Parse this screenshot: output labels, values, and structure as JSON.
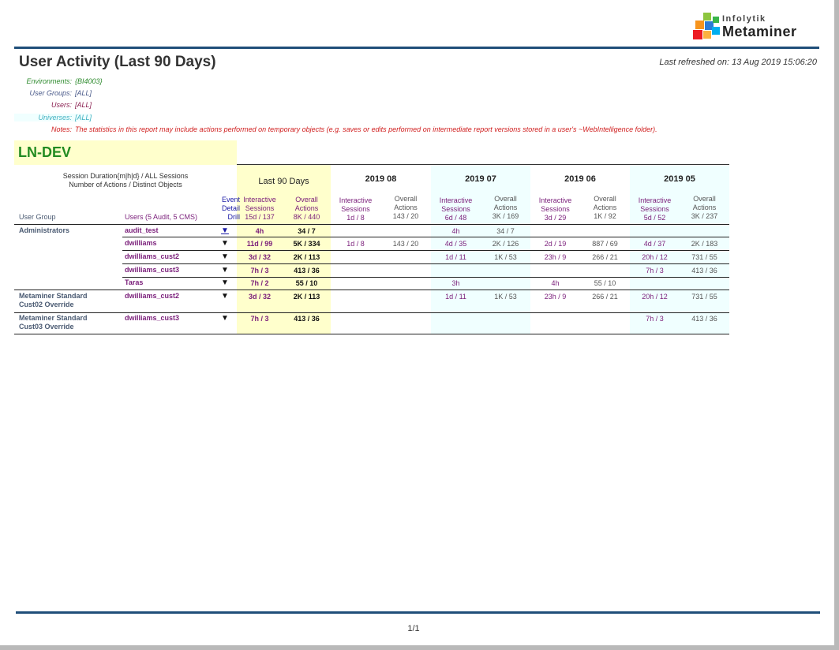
{
  "logo": {
    "small": "Infolytik",
    "big": "Metaminer"
  },
  "report": {
    "title": "User Activity (Last 90 Days)",
    "refreshed": "Last refreshed on: 13 Aug 2019 15:06:20"
  },
  "meta": {
    "environments": {
      "label": "Environments:",
      "value": "{BI4003}",
      "color": "#2e8b2e"
    },
    "user_groups": {
      "label": "User Groups:",
      "value": "[ALL]",
      "color": "#4a5a8a"
    },
    "users": {
      "label": "Users:",
      "value": "[ALL]",
      "color": "#8b2252"
    },
    "universes": {
      "label": "Universes:",
      "value": "[ALL]",
      "color": "#3fb0c0"
    },
    "notes": {
      "label": "Notes:",
      "value": "The statistics in this report may include actions performed on temporary objects (e.g. saves or edits performed on intermediate report versions stored in a user's ~WebIntelligence folder).",
      "color": "#d02020"
    }
  },
  "section": {
    "name": "LN-DEV"
  },
  "legend": {
    "line1": "Session Duration{m|h|d} / ALL Sessions",
    "line2": "Number of Actions / Distinct Objects"
  },
  "columns": {
    "user_group": "User Group",
    "users": "Users (5 Audit, 5 CMS)",
    "drill": [
      "Event",
      "Detail",
      "Drill"
    ],
    "interactive": [
      "Interactive",
      "Sessions"
    ],
    "overall": [
      "Overall",
      "Actions"
    ]
  },
  "periods": [
    {
      "title": "Last 90 Days",
      "interactive_total": "15d / 137",
      "overall_total": "8K / 440",
      "band": "#ffffcc"
    },
    {
      "title": "2019 08",
      "interactive_total": "1d / 8",
      "overall_total": "143 / 20",
      "band": "#ffffff"
    },
    {
      "title": "2019 07",
      "interactive_total": "6d / 48",
      "overall_total": "3K / 169",
      "band": "#f0ffff"
    },
    {
      "title": "2019 06",
      "interactive_total": "3d / 29",
      "overall_total": "1K / 92",
      "band": "#ffffff"
    },
    {
      "title": "2019 05",
      "interactive_total": "5d / 52",
      "overall_total": "3K / 237",
      "band": "#f0ffff"
    }
  ],
  "rows": [
    {
      "group": [
        "Administrators"
      ],
      "user": "audit_test",
      "drill": "▼",
      "values": [
        [
          "4h",
          "34 / 7"
        ],
        [
          "",
          ""
        ],
        [
          "4h",
          "34 / 7"
        ],
        [
          "",
          ""
        ],
        [
          "",
          ""
        ]
      ]
    },
    {
      "group": [],
      "user": "dwilliams",
      "drill": "▼",
      "values": [
        [
          "11d / 99",
          "5K / 334"
        ],
        [
          "1d / 8",
          "143 / 20"
        ],
        [
          "4d / 35",
          "2K / 126"
        ],
        [
          "2d / 19",
          "887 / 69"
        ],
        [
          "4d / 37",
          "2K / 183"
        ]
      ]
    },
    {
      "group": [],
      "user": "dwilliams_cust2",
      "drill": "▼",
      "values": [
        [
          "3d / 32",
          "2K / 113"
        ],
        [
          "",
          ""
        ],
        [
          "1d / 11",
          "1K / 53"
        ],
        [
          "23h / 9",
          "266 / 21"
        ],
        [
          "20h / 12",
          "731 / 55"
        ]
      ]
    },
    {
      "group": [],
      "user": "dwilliams_cust3",
      "drill": "▼",
      "values": [
        [
          "7h / 3",
          "413 / 36"
        ],
        [
          "",
          ""
        ],
        [
          "",
          ""
        ],
        [
          "",
          ""
        ],
        [
          "7h / 3",
          "413 / 36"
        ]
      ]
    },
    {
      "group": [],
      "user": "Taras",
      "drill": "▼",
      "values": [
        [
          "7h / 2",
          "55 / 10"
        ],
        [
          "",
          ""
        ],
        [
          "3h",
          ""
        ],
        [
          "4h",
          "55 / 10"
        ],
        [
          "",
          ""
        ]
      ]
    },
    {
      "group": [
        "Metaminer Standard",
        "Cust02 Override"
      ],
      "user": "dwilliams_cust2",
      "drill": "▼",
      "values": [
        [
          "3d / 32",
          "2K / 113"
        ],
        [
          "",
          ""
        ],
        [
          "1d / 11",
          "1K / 53"
        ],
        [
          "23h / 9",
          "266 / 21"
        ],
        [
          "20h / 12",
          "731 / 55"
        ]
      ]
    },
    {
      "group": [
        "Metaminer Standard",
        "Cust03 Override"
      ],
      "user": "dwilliams_cust3",
      "drill": "▼",
      "values": [
        [
          "7h / 3",
          "413 / 36"
        ],
        [
          "",
          ""
        ],
        [
          "",
          ""
        ],
        [
          "",
          ""
        ],
        [
          "7h / 3",
          "413 / 36"
        ]
      ]
    }
  ],
  "footer": {
    "page": "1/1"
  }
}
